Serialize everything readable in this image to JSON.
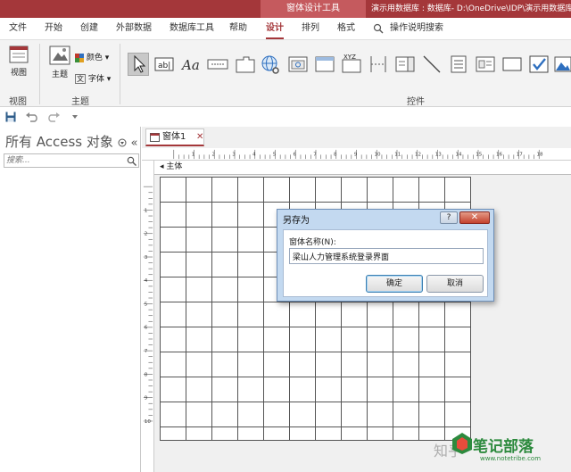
{
  "title_bar": {
    "context_tab": "窗体设计工具",
    "window_title": "演示用数据库 : 数据库- D:\\OneDrive\\IDP\\演示用数据库"
  },
  "ribbon_tabs": [
    "文件",
    "开始",
    "创建",
    "外部数据",
    "数据库工具",
    "帮助",
    "设计",
    "排列",
    "格式"
  ],
  "active_tab": "设计",
  "tell_me": "操作说明搜索",
  "ribbon": {
    "view_label": "视图",
    "view_group": "视图",
    "theme_label": "主题",
    "colors_label": "颜色",
    "fonts_label": "字体",
    "theme_group": "主题",
    "controls_group": "控件",
    "label_ctl_text": "Aa",
    "textbox_ctl_text": "ab|",
    "xyz_text": "XYZ"
  },
  "nav": {
    "title": "所有 Access 对象",
    "collapse": "«",
    "search_placeholder": "搜索..."
  },
  "document": {
    "tab_label": "窗体1",
    "section_label": "主体",
    "ruler_h": [
      "1",
      "2",
      "3",
      "4",
      "5",
      "6",
      "7",
      "8",
      "9",
      "10",
      "11",
      "12",
      "13",
      "14",
      "15",
      "16",
      "17",
      "18"
    ],
    "ruler_v": [
      "1",
      "2",
      "3",
      "4",
      "5",
      "6",
      "7",
      "8",
      "9",
      "10"
    ]
  },
  "dialog": {
    "title": "另存为",
    "help": "?",
    "close": "✕",
    "label": "窗体名称(N):",
    "value": "梁山人力管理系统登录界面",
    "ok": "确定",
    "cancel": "取消"
  },
  "watermark": {
    "zhihu": "知乎",
    "brand": "笔记部落",
    "url": "www.notetribe.com"
  }
}
